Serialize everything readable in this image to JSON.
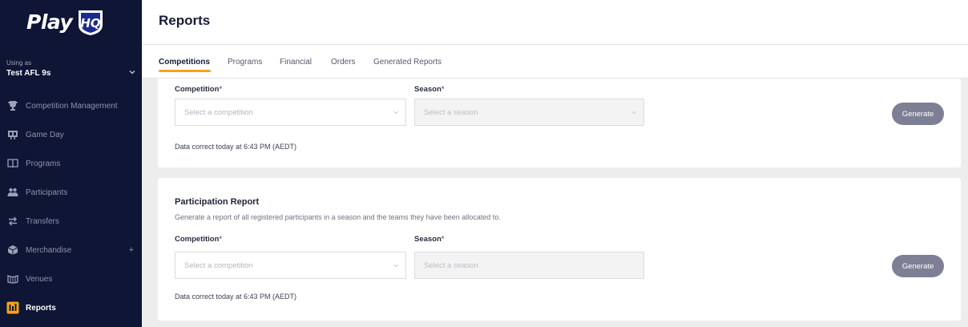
{
  "sidebar": {
    "logo_text": "Play",
    "logo_badge": "HQ",
    "using_as_label": "Using as",
    "org_name": "Test AFL 9s",
    "items": [
      {
        "label": "Competition Management",
        "icon": "trophy-icon"
      },
      {
        "label": "Game Day",
        "icon": "scoreboard-icon"
      },
      {
        "label": "Programs",
        "icon": "book-icon"
      },
      {
        "label": "Participants",
        "icon": "people-icon"
      },
      {
        "label": "Transfers",
        "icon": "transfer-arrows-icon"
      },
      {
        "label": "Merchandise",
        "icon": "box-icon",
        "expand": "+"
      },
      {
        "label": "Venues",
        "icon": "stadium-icon"
      },
      {
        "label": "Reports",
        "icon": "reports-icon",
        "active": true
      }
    ]
  },
  "header": {
    "title": "Reports"
  },
  "tabs": [
    {
      "label": "Competitions",
      "active": true
    },
    {
      "label": "Programs"
    },
    {
      "label": "Financial"
    },
    {
      "label": "Orders"
    },
    {
      "label": "Generated Reports"
    }
  ],
  "report1": {
    "competition_label": "Competition",
    "season_label": "Season",
    "required_marker": "*",
    "competition_placeholder": "Select a competition",
    "season_placeholder": "Select a season",
    "note": "Data correct today at 6:43 PM (AEDT)",
    "button": "Generate"
  },
  "report2": {
    "title": "Participation Report",
    "description": "Generate a report of all registered participants in a season and the teams they have been allocated to.",
    "competition_label": "Competition",
    "season_label": "Season",
    "required_marker": "*",
    "competition_placeholder": "Select a competition",
    "season_placeholder": "Select a season",
    "note": "Data correct today at 6:43 PM (AEDT)",
    "button": "Generate"
  },
  "colors": {
    "sidebar_bg": "#0e1535",
    "accent": "#f6a21c",
    "button_bg": "#7d7f95",
    "main_bg": "#ededed"
  }
}
